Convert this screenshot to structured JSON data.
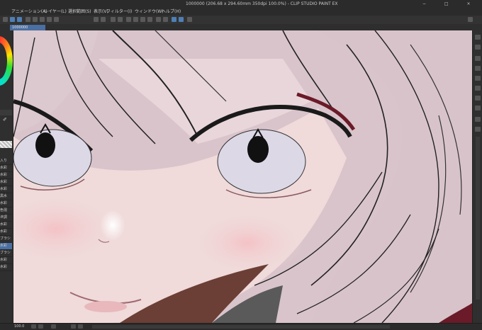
{
  "app": {
    "title": "1000000 (206.68 x 294.60mm 350dpi 100.0%) - CLIP STUDIO PAINT EX",
    "window_controls": "− □ ×"
  },
  "menu": {
    "items": [
      "アニメーション(A)",
      "レイヤー(L)",
      "選択範囲(S)",
      "表示(V)",
      "フィルター(I)",
      "ウィンドウ(W)",
      "ヘルプ(H)"
    ]
  },
  "canvas_tab": {
    "label": "1000000"
  },
  "left_panel": {
    "items": [
      "入り",
      "水彩",
      "水彩",
      "水彩",
      "水彩",
      "黒水",
      "水彩",
      "色混",
      "滲調",
      "水彩",
      "水彩",
      "ブラシ",
      "水彩",
      "ブラシ",
      "水彩",
      "水彩"
    ],
    "selected_index": 12
  },
  "status": {
    "zoom": "100.0"
  },
  "colors": {
    "accent": "#4a6fa0",
    "skin": "#f0dada",
    "hair": "#d9c4cb",
    "iris": "#dcd8e6"
  }
}
